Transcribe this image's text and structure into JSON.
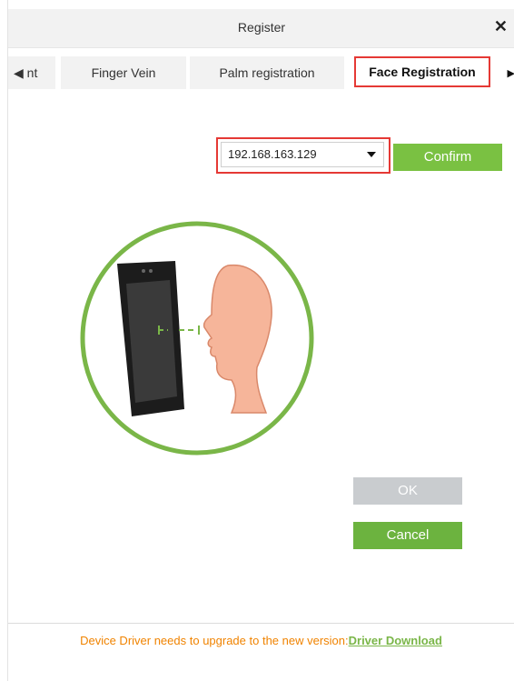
{
  "dialog": {
    "title": "Register",
    "close_label": "✕"
  },
  "tabs": {
    "left_arrow_label": "◀ nt",
    "items": [
      {
        "label": "Finger Vein"
      },
      {
        "label": "Palm registration"
      },
      {
        "label": "Face Registration",
        "active": true
      }
    ],
    "right_arrow_label": "▶"
  },
  "device": {
    "selected_ip": "192.168.163.129",
    "confirm_label": "Confirm"
  },
  "actions": {
    "ok_label": "OK",
    "cancel_label": "Cancel"
  },
  "footer": {
    "message": "Device Driver needs to upgrade to the new version:",
    "link_label": "Driver Download"
  },
  "colors": {
    "accent_green": "#7ac142",
    "highlight_red": "#e53935",
    "warning_orange": "#f08300"
  }
}
